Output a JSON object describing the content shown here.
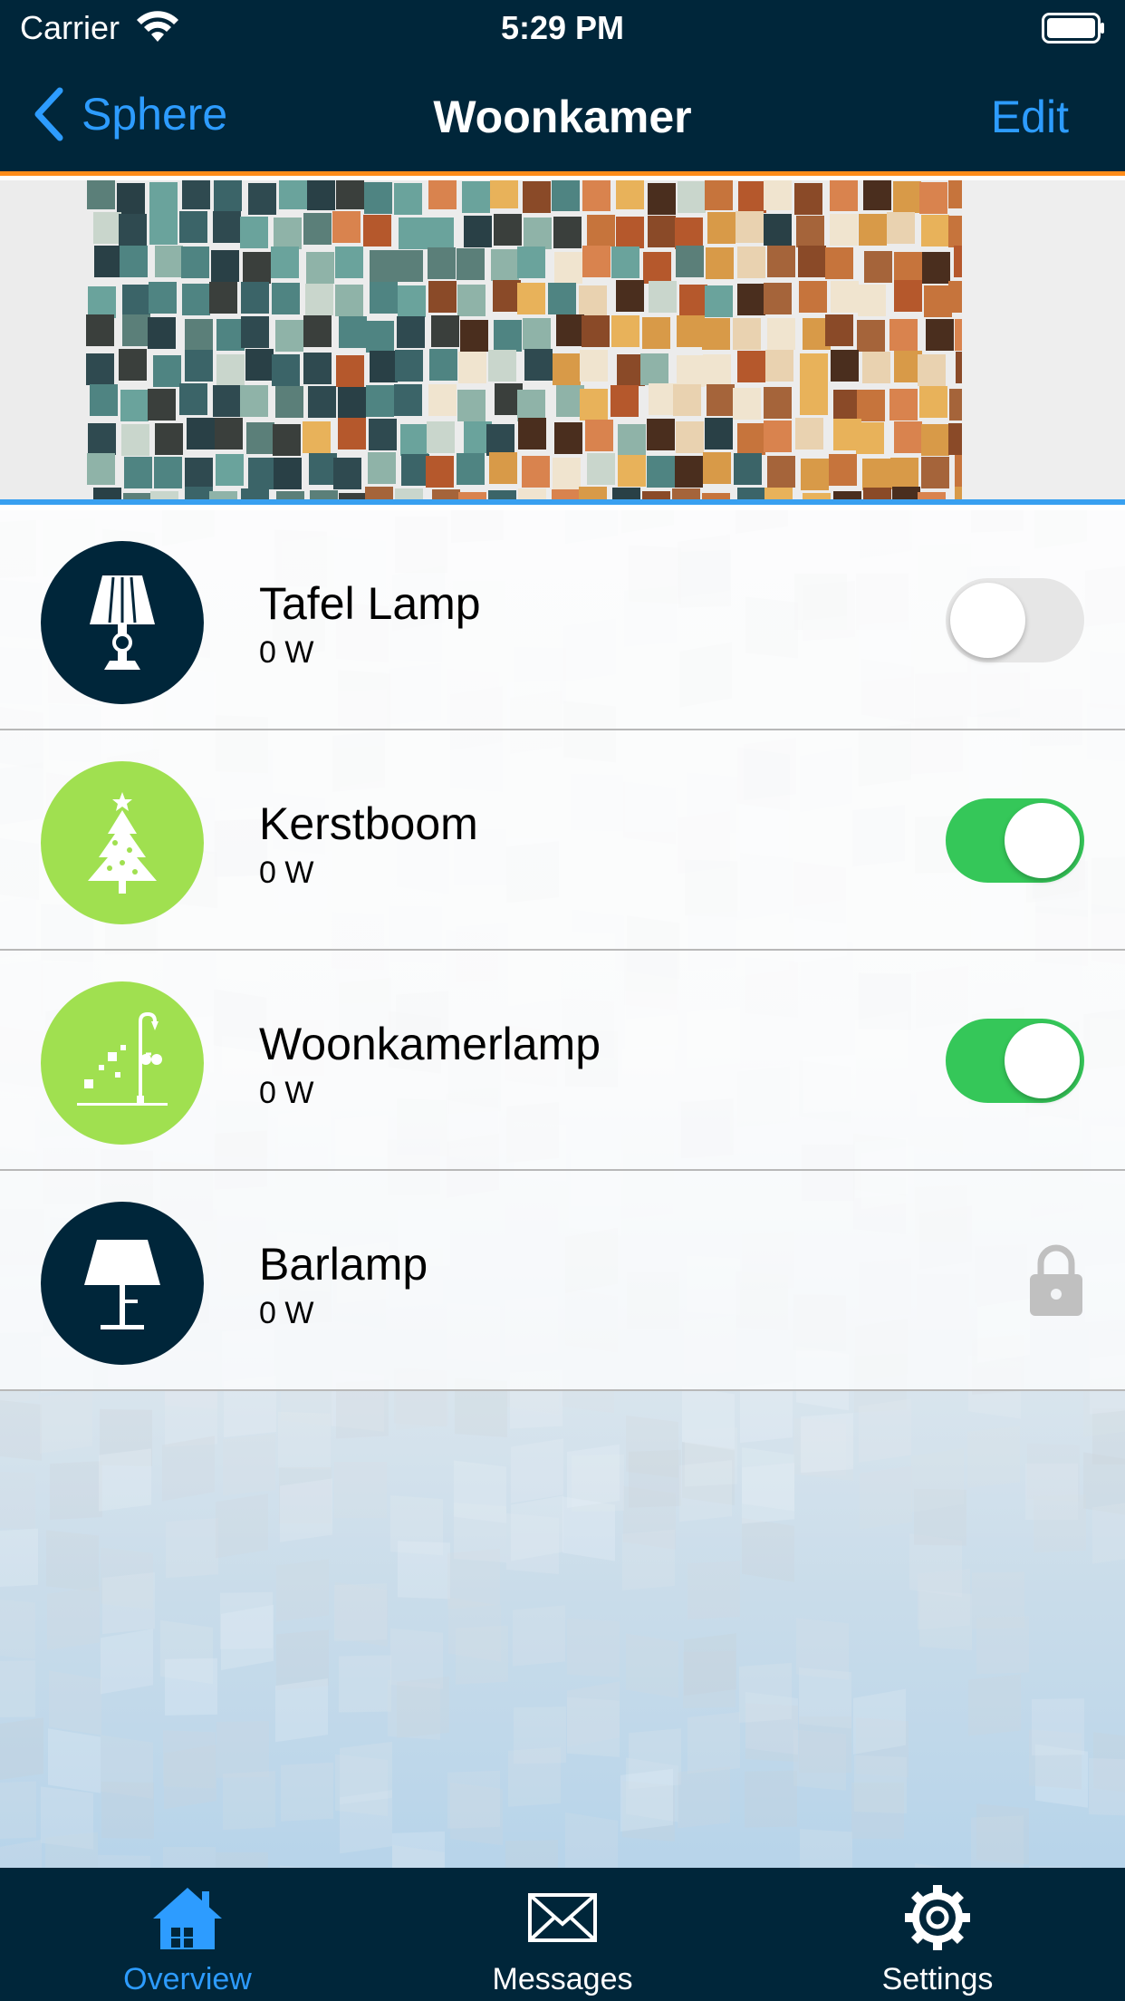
{
  "status_bar": {
    "carrier": "Carrier",
    "time": "5:29 PM"
  },
  "nav": {
    "back_label": "Sphere",
    "title": "Woonkamer",
    "edit_label": "Edit"
  },
  "colors": {
    "nav_background": "#00263a",
    "accent_blue": "#2d9cff",
    "nav_underline": "#ff8c1a",
    "hero_underline": "#39a0f0",
    "toggle_on": "#35c759",
    "icon_dark": "#00263a",
    "icon_green": "#a0e050"
  },
  "devices": [
    {
      "name": "Tafel Lamp",
      "power": "0 W",
      "icon": "table-lamp-icon",
      "icon_color": "#00263a",
      "control": "toggle",
      "on": false
    },
    {
      "name": "Kerstboom",
      "power": "0 W",
      "icon": "christmas-tree-icon",
      "icon_color": "#a0e050",
      "control": "toggle",
      "on": true
    },
    {
      "name": "Woonkamerlamp",
      "power": "0 W",
      "icon": "street-lamp-icon",
      "icon_color": "#a0e050",
      "control": "toggle",
      "on": true
    },
    {
      "name": "Barlamp",
      "power": "0 W",
      "icon": "floor-lamp-icon",
      "icon_color": "#00263a",
      "control": "lock",
      "on": false
    }
  ],
  "tabs": [
    {
      "label": "Overview",
      "icon": "house-icon",
      "active": true
    },
    {
      "label": "Messages",
      "icon": "envelope-icon",
      "active": false
    },
    {
      "label": "Settings",
      "icon": "gear-icon",
      "active": false
    }
  ]
}
